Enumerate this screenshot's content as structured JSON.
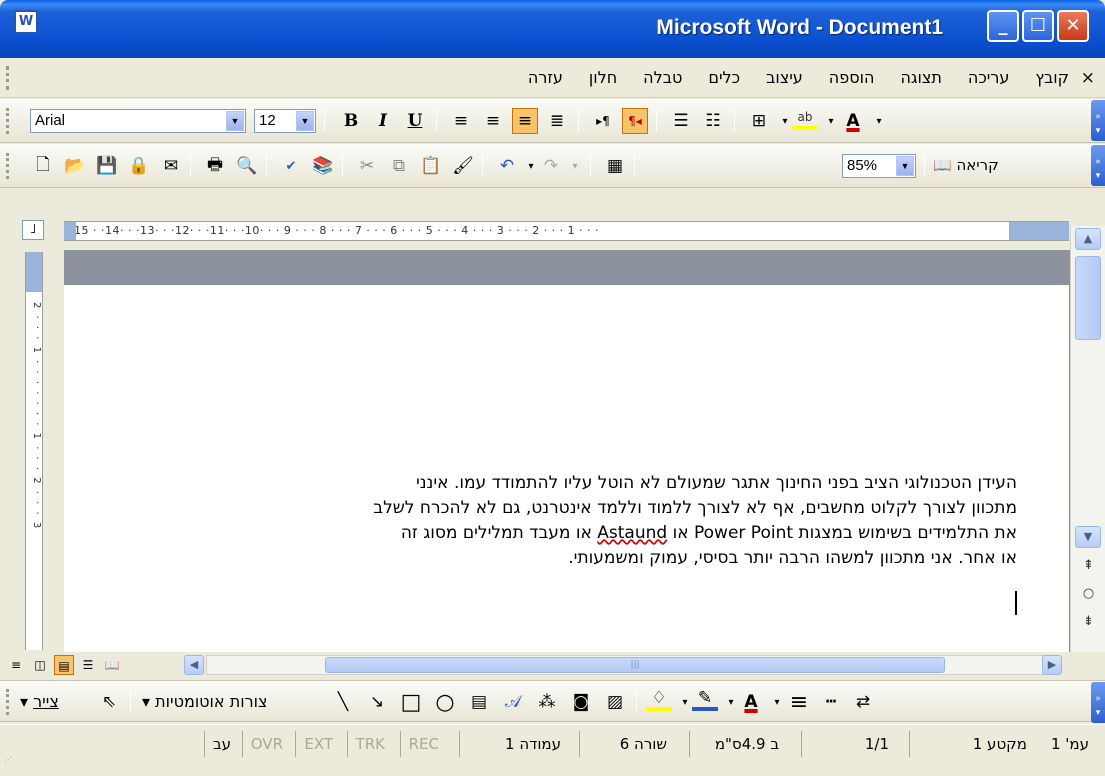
{
  "window": {
    "title": "Microsoft Word - Document1",
    "app_icon": "word-document-icon",
    "minimize": "_",
    "maximize": "☐",
    "close": "✕"
  },
  "menubar": {
    "close": "×",
    "items": [
      "קובץ",
      "עריכה",
      "תצוגה",
      "הוספה",
      "עיצוב",
      "כלים",
      "טבלה",
      "חלון",
      "עזרה"
    ]
  },
  "formatting_toolbar": {
    "font": "Arial",
    "size": "12",
    "bold": "B",
    "italic": "I",
    "underline": "U",
    "align_icons": [
      "align-left-icon",
      "center-icon",
      "align-right-icon",
      "justify-icon"
    ],
    "ltr_icon": "▸¶",
    "rtl_icon": "¶◂",
    "highlight_color": "#ffff00",
    "font_color": "#cc0000"
  },
  "standard_toolbar": {
    "zoom": "85%",
    "read_label": "קריאה"
  },
  "ruler": {
    "numbers": "·15 · ·14· · ·13· · ·12· · ·11· · ·10· · · 9 · · · 8 · · · 7 · · · 6 · · · 5 · · · 4 · · · 3 · · · 2 · · · 1 · · ·",
    "tab_selector": "˩",
    "vertical_ticks": "2 · · · 1 · · · · · · · 1 · · · 2 · · · 3"
  },
  "document": {
    "line1": "העידן הטכנולוגי הציב בפני החינוך אתגר שמעולם לא הוטל עליו להתמודד עמו. אינני",
    "line2": "מתכוון לצורך לקלוט מחשבים, אף לא לצורך ללמוד וללמד אינטרנט, גם לא להכרח לשלב",
    "line3_before": "את התלמידים בשימוש במצגות Power Point או ",
    "line3_squiggle": "Astaund",
    "line3_after": " או מעבד תמלילים מסוג זה",
    "line4": "או אחר. אני מתכוון למשהו הרבה יותר בסיסי, עמוק ומשמעותי."
  },
  "drawing_toolbar": {
    "draw_label": "צייר",
    "autoshapes_label": "צורות אוטומטיות"
  },
  "statusbar": {
    "page": "עמ' 1",
    "section": "מקטע 1",
    "pages": "1/1",
    "position": "ב 4.9ס\"מ",
    "line": "שורה 6",
    "column": "עמודה 1",
    "rec": "REC",
    "trk": "TRK",
    "ext": "EXT",
    "ovr": "OVR",
    "lang": "עב"
  }
}
